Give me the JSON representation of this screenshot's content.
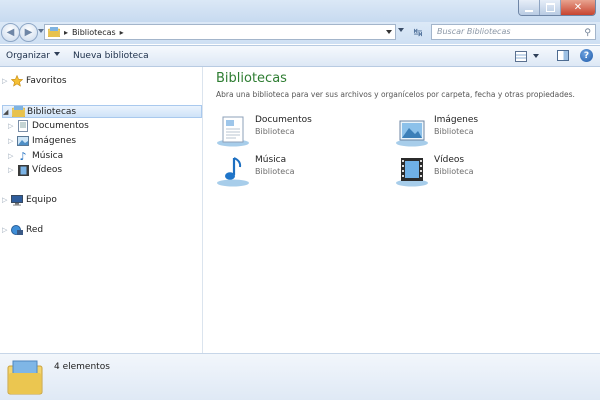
{
  "window": {
    "buttons": [
      "minimize",
      "maximize",
      "close"
    ]
  },
  "address_bar": {
    "crumbs": [
      "Bibliotecas"
    ],
    "search_placeholder": "Buscar Bibliotecas"
  },
  "toolbar": {
    "organize_label": "Organizar",
    "new_library_label": "Nueva biblioteca"
  },
  "nav_pane": {
    "favorites": "Favoritos",
    "libraries": "Bibliotecas",
    "library_items": [
      "Documentos",
      "Imágenes",
      "Música",
      "Vídeos"
    ],
    "computer": "Equipo",
    "network": "Red"
  },
  "main": {
    "title": "Bibliotecas",
    "subtitle": "Abra una biblioteca para ver sus archivos y organícelos por carpeta, fecha y otras propiedades.",
    "libraries": [
      {
        "name": "Documentos",
        "type": "Biblioteca",
        "icon": "documents-library-icon"
      },
      {
        "name": "Imágenes",
        "type": "Biblioteca",
        "icon": "pictures-library-icon"
      },
      {
        "name": "Música",
        "type": "Biblioteca",
        "icon": "music-library-icon"
      },
      {
        "name": "Vídeos",
        "type": "Biblioteca",
        "icon": "videos-library-icon"
      }
    ]
  },
  "status_bar": {
    "count": "4 elementos"
  },
  "colors": {
    "title_green": "#2e7d32",
    "chrome_blue": "#dce9f7"
  }
}
